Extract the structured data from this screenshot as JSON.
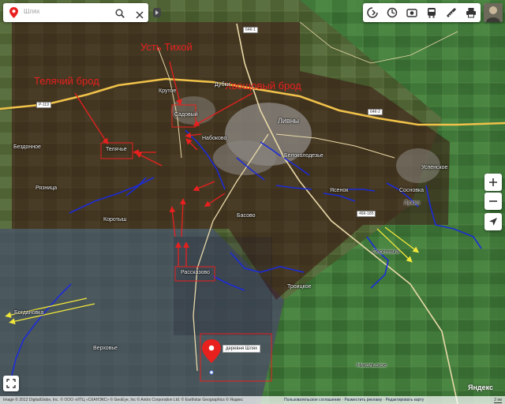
{
  "search": {
    "value": "Шлях"
  },
  "map_labels": {
    "teliachiy_brod": "Телячий брод",
    "ust_tikhoy": "Усть Тихой",
    "khvoshchovy_brod": "Хвощовый брод",
    "target_village": "деревня Шлях"
  },
  "places": {
    "teliachye": "Телячье",
    "sadovy": "Садовый",
    "livny": "Ливны",
    "rasskazovo": "Рассказово",
    "krutoe": "Крутое",
    "dubki": "Дубки",
    "nabokovo": "Набоково",
    "belokolodezye": "Белоколодезье",
    "basovo": "Басово",
    "troitskoe": "Троицкое",
    "uspenskoe": "Успенское",
    "sosnovka": "Сосновка",
    "korotysh": "Коротыш",
    "raznitsa": "Рязница",
    "bezdonnoe": "Бездонное",
    "bogdanovka": "Богдановка",
    "verkhovye": "Верховье",
    "luzhki": "Лужки",
    "sergeevka": "Сергеевка",
    "nikolskoe": "Никольское",
    "yasenok": "Ясенок"
  },
  "road_badges": {
    "r119": "Р-119",
    "r64": "64К-1",
    "r46": "46К-185",
    "m64": "64К-2"
  },
  "footer": {
    "copyright": "Image © 2012 DigitalGlobe, Inc. © ООО «ИТЦ «СКАНЭКС» © GeoEye, Inc © Antrix Corporation Ltd. © Earthstar Geographics © Яндекс",
    "links": "Пользовательское соглашение · Разместить рекламу · Редактировать карту",
    "scale": "2 км",
    "brand": "Яндекс"
  },
  "colors": {
    "pin_red": "#e8201e",
    "river_blue": "#1c2bd8",
    "arrow_red": "#e8201e",
    "arrow_yellow": "#f2e63a",
    "road_yellow": "#f0c24a"
  },
  "icons": {
    "search": "search-icon",
    "close": "close-icon",
    "layers": "layers-icon",
    "traffic": "traffic-icon",
    "panorama": "panorama-icon",
    "transit": "bus-icon",
    "ruler": "ruler-icon",
    "print": "print-icon",
    "zoom_in": "plus-icon",
    "zoom_out": "minus-icon",
    "locate": "locate-icon",
    "fullscreen": "fullscreen-icon"
  }
}
